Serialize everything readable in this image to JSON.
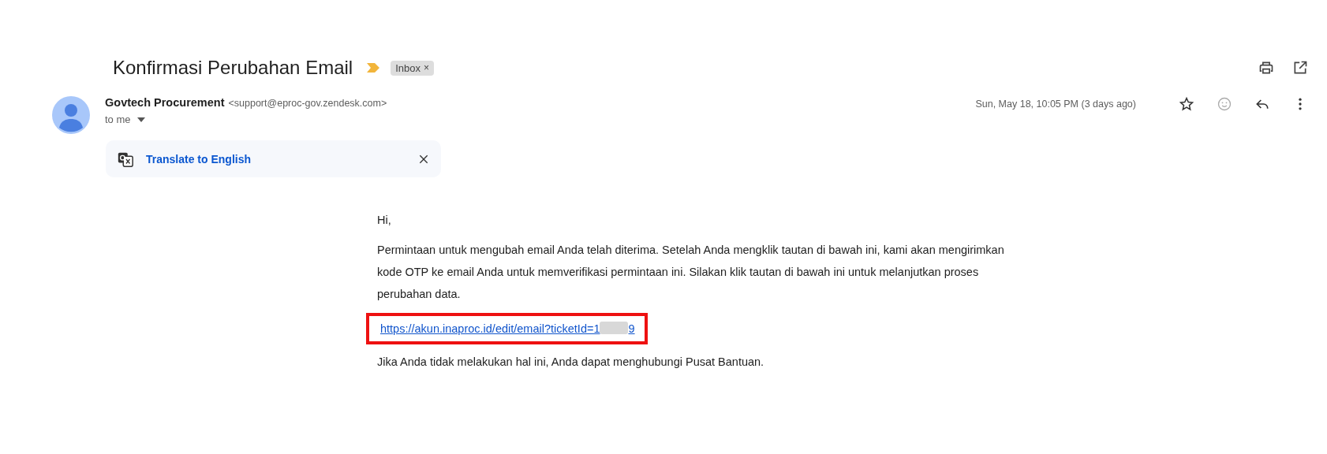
{
  "subject": {
    "title": "Konfirmasi Perubahan Email",
    "important": true,
    "labels": [
      {
        "text": "Inbox",
        "close": "×"
      }
    ]
  },
  "sender": {
    "name": "Govtech Procurement",
    "address": "<support@eproc-gov.zendesk.com>",
    "recipient": "to me",
    "date": "Sun, May 18, 10:05 PM (3 days ago)",
    "starred": false
  },
  "translate": {
    "link": "Translate to English"
  },
  "body": {
    "greeting": "Hi,",
    "paragraph": "Permintaan untuk mengubah email Anda telah diterima. Setelah Anda mengklik tautan di bawah ini, kami akan mengirimkan kode OTP ke email Anda untuk memverifikasi permintaan ini. Silakan klik tautan di bawah ini untuk melanjutkan proses perubahan data.",
    "link": {
      "start": "https://akun.inaproc.id/edit/email?ticketId=1",
      "end": "9",
      "redacted": true,
      "highlighted": true
    },
    "closing": "Jika Anda tidak melakukan hal ini, Anda dapat menghubungi Pusat Bantuan."
  }
}
